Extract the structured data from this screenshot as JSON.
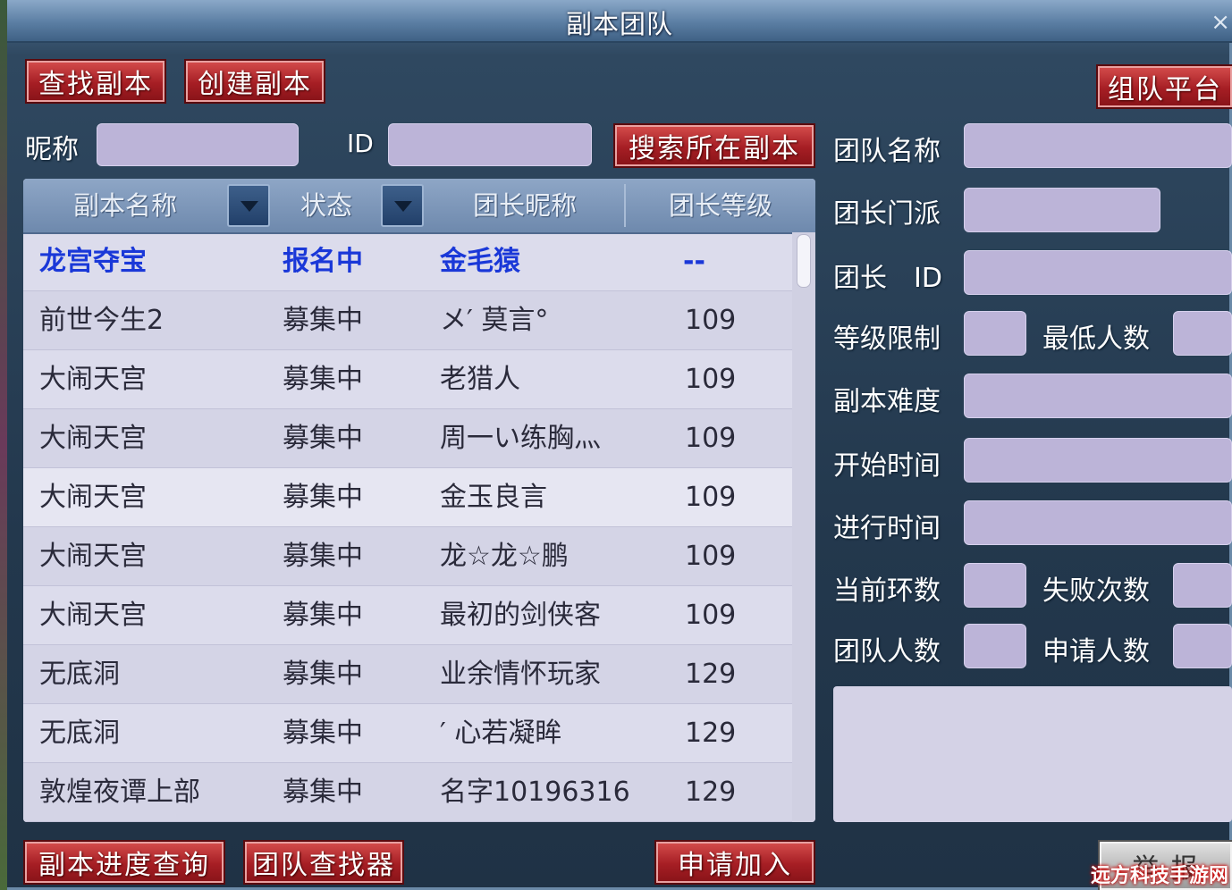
{
  "window": {
    "title": "副本团队",
    "close_glyph": "×"
  },
  "buttons": {
    "find_dungeon": "查找副本",
    "create_dungeon": "创建副本",
    "team_platform": "组队平台",
    "search_current": "搜索所在副本",
    "progress_query": "副本进度查询",
    "team_finder": "团队查找器",
    "apply_join": "申请加入",
    "bottom_right": "举 报"
  },
  "search": {
    "nickname_label": "昵称",
    "id_label": "ID",
    "nickname_value": "",
    "id_value": ""
  },
  "table": {
    "headers": [
      "副本名称",
      "状态",
      "团长昵称",
      "团长等级"
    ],
    "rows": [
      {
        "name": "龙宫夺宝",
        "status": "报名中",
        "leader": "金毛猿",
        "level": "--"
      },
      {
        "name": "前世今生2",
        "status": "募集中",
        "leader": "メ′ 莫言°",
        "level": "109"
      },
      {
        "name": "大闹天宫",
        "status": "募集中",
        "leader": "老猎人",
        "level": "109"
      },
      {
        "name": "大闹天宫",
        "status": "募集中",
        "leader": "周一い练胸灬",
        "level": "109"
      },
      {
        "name": "大闹天宫",
        "status": "募集中",
        "leader": "金玉良言",
        "level": "109"
      },
      {
        "name": "大闹天宫",
        "status": "募集中",
        "leader": "龙☆龙☆鹏",
        "level": "109"
      },
      {
        "name": "大闹天宫",
        "status": "募集中",
        "leader": "最初的剑侠客",
        "level": "109"
      },
      {
        "name": "无底洞",
        "status": "募集中",
        "leader": "业余情怀玩家",
        "level": "129"
      },
      {
        "name": "无底洞",
        "status": "募集中",
        "leader": "′ 心若凝眸",
        "level": "129"
      },
      {
        "name": "敦煌夜谭上部",
        "status": "募集中",
        "leader": "名字10196316",
        "level": "129"
      }
    ]
  },
  "details": {
    "team_name": "团队名称",
    "leader_sect": "团长门派",
    "leader_id": "团长　ID",
    "level_limit": "等级限制",
    "min_players": "最低人数",
    "difficulty": "副本难度",
    "start_time": "开始时间",
    "duration": "进行时间",
    "current_round": "当前环数",
    "fail_count": "失败次数",
    "team_size": "团队人数",
    "apply_count": "申请人数"
  },
  "watermark": "远方科技手游网",
  "colors": {
    "button_red": "#a61e24",
    "field_lavender": "#bcb4d8",
    "selected_blue": "#1a38d8"
  }
}
